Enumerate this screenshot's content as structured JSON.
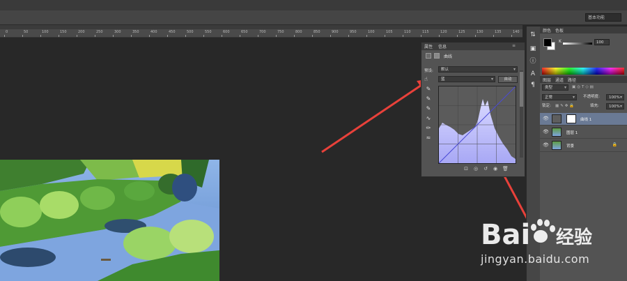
{
  "workspace": {
    "label": "基本功能"
  },
  "ruler": {
    "marks": [
      "0",
      "50",
      "100",
      "150",
      "200",
      "250",
      "300",
      "350",
      "400",
      "450",
      "500",
      "550",
      "600",
      "650",
      "700",
      "750",
      "800",
      "850",
      "900",
      "950",
      "100",
      "105",
      "110",
      "115",
      "120",
      "125",
      "130",
      "135",
      "140"
    ]
  },
  "properties_panel": {
    "tabs": [
      "属性",
      "信息"
    ],
    "title": "曲线",
    "preset_label": "预设:",
    "preset_value": "默认",
    "channel_value": "蓝",
    "auto_button": "自动"
  },
  "color_panel": {
    "tabs": [
      "颜色",
      "色板"
    ],
    "channel_label": "K",
    "channel_value": "100"
  },
  "layers_panel": {
    "tabs": [
      "图层",
      "通道",
      "路径"
    ],
    "kind_value": "类型",
    "blend_mode": "正常",
    "opacity_label": "不透明度:",
    "opacity_value": "100%",
    "lock_label": "锁定:",
    "fill_label": "填充:",
    "fill_value": "100%",
    "layers": [
      {
        "name": "曲线 1",
        "selected": true
      },
      {
        "name": "图层 1",
        "selected": false
      },
      {
        "name": "背景",
        "selected": false
      }
    ]
  },
  "watermark": {
    "brand": "Bai",
    "brand_suffix": "经验",
    "url": "jingyan.baidu.com"
  },
  "colors": {
    "arrow": "#e8413a",
    "histogram": "#b8b8ff",
    "curve": "#4b4bd6",
    "selected_layer": "#6a7a95"
  }
}
